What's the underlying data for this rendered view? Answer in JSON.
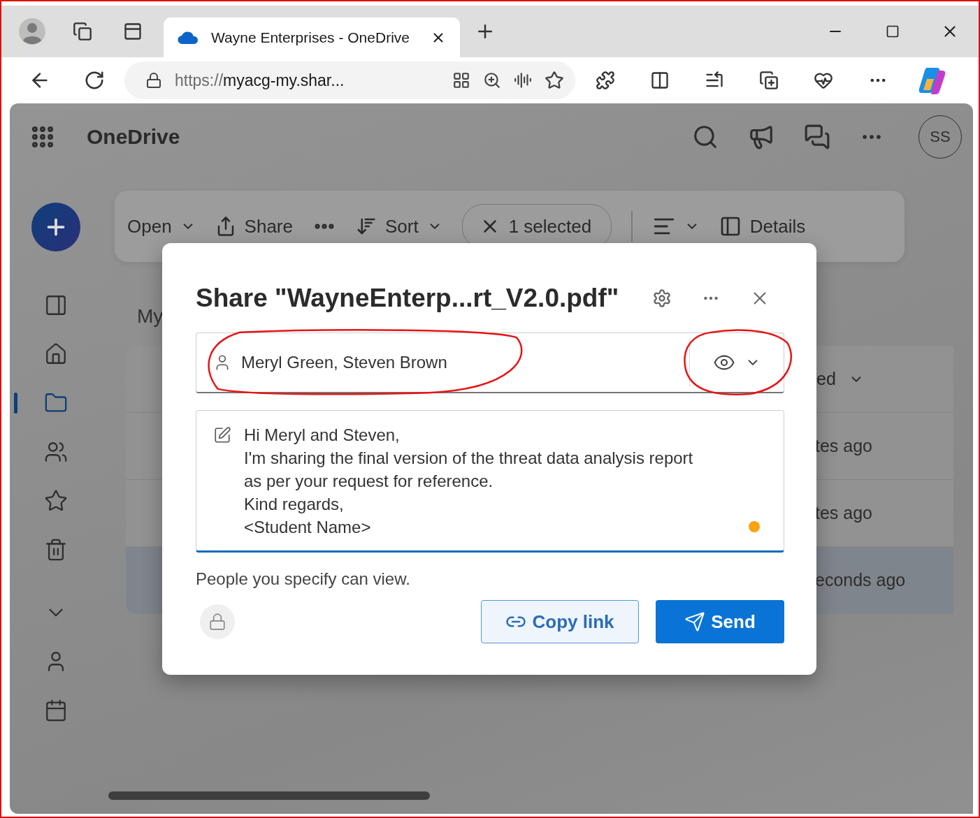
{
  "browser": {
    "tabs": [
      {
        "title": "Wayne Enterprises - OneDrive",
        "selected": true
      }
    ],
    "address": {
      "scheme": "https://",
      "host": "myacg-my.shar..."
    }
  },
  "app": {
    "name": "OneDrive",
    "avatar": "SS"
  },
  "commands": [
    {
      "kind": "open",
      "label": "Open"
    },
    {
      "kind": "share",
      "label": "Share"
    },
    {
      "kind": "more"
    },
    {
      "kind": "sort",
      "label": "Sort"
    },
    {
      "kind": "selection",
      "label": "1 selected"
    },
    {
      "kind": "view"
    },
    {
      "kind": "details",
      "label": "Details"
    }
  ],
  "nav": [
    {
      "kind": "pane",
      "selected": false
    },
    {
      "kind": "home",
      "selected": false
    },
    {
      "kind": "folder",
      "selected": true
    },
    {
      "kind": "people",
      "selected": false
    },
    {
      "kind": "star",
      "selected": false
    },
    {
      "kind": "recycle",
      "selected": false
    },
    {
      "kind": "expand",
      "selected": false
    },
    {
      "kind": "person",
      "selected": false
    },
    {
      "kind": "calendar",
      "selected": false
    }
  ],
  "page": {
    "heading": "My",
    "column_header": "ed",
    "rows": [
      {
        "modified": "tes ago",
        "selected": false
      },
      {
        "modified": "tes ago",
        "selected": false
      },
      {
        "modified": "econds ago",
        "selected": true
      }
    ]
  },
  "dialog": {
    "title": "Share \"WayneEnterp...rt_V2.0.pdf\"",
    "recipients": {
      "value": "Meryl Green, Steven Brown",
      "highlighted": true
    },
    "permission": {
      "highlighted": true
    },
    "message": [
      "Hi Meryl and Steven,",
      "I'm sharing the final version of the threat data analysis report",
      "as per your request for reference.",
      "Kind regards,",
      "<Student Name>"
    ],
    "caption": "People you specify can view.",
    "buttons": [
      {
        "kind": "copy",
        "label": "Copy link"
      },
      {
        "kind": "send",
        "label": "Send"
      }
    ]
  }
}
